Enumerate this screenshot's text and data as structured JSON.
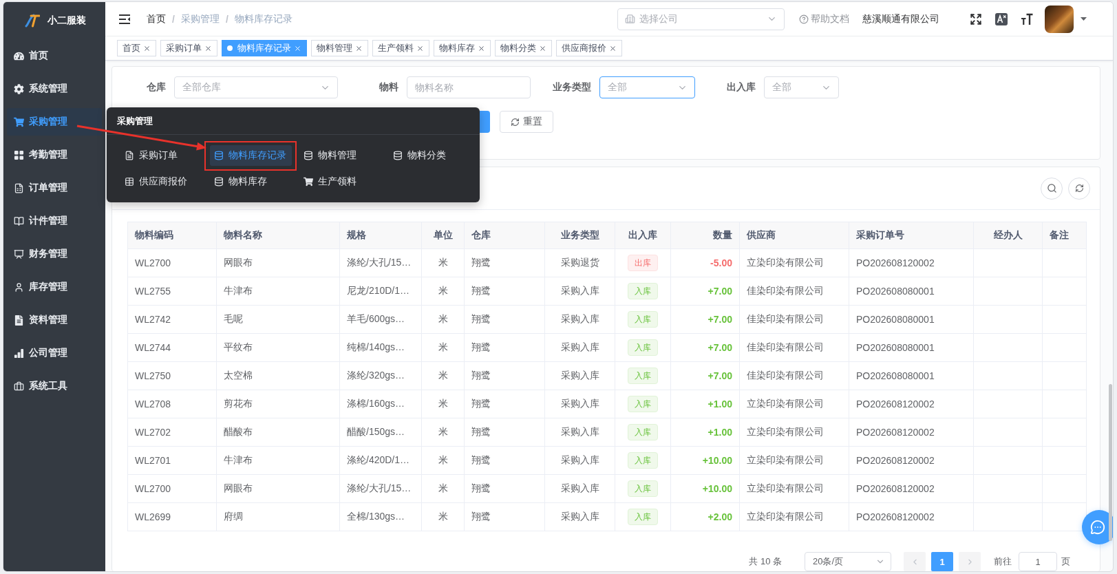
{
  "sidebar": {
    "logo": "小二服装",
    "items": [
      {
        "label": "首页",
        "selected": false
      },
      {
        "label": "系统管理",
        "selected": false
      },
      {
        "label": "采购管理",
        "selected": true
      },
      {
        "label": "考勤管理",
        "selected": false
      },
      {
        "label": "订单管理",
        "selected": false
      },
      {
        "label": "计件管理",
        "selected": false
      },
      {
        "label": "财务管理",
        "selected": false
      },
      {
        "label": "库存管理",
        "selected": false
      },
      {
        "label": "资料管理",
        "selected": false
      },
      {
        "label": "公司管理",
        "selected": false
      },
      {
        "label": "系统工具",
        "selected": false
      }
    ]
  },
  "header": {
    "breadcrumb": [
      {
        "label": "首页",
        "link": true,
        "separator": "/"
      },
      {
        "label": "采购管理",
        "link": false,
        "separator": "/"
      },
      {
        "label": "物料库存记录",
        "link": false
      }
    ],
    "company_select": {
      "placeholder": "选择公司"
    },
    "help_link": "帮助文档",
    "company_name": "慈溪顺通有限公司"
  },
  "tags": [
    {
      "label": "首页",
      "selected": false
    },
    {
      "label": "采购订单",
      "selected": false
    },
    {
      "label": "物料库存记录",
      "selected": true
    },
    {
      "label": "物料管理",
      "selected": false
    },
    {
      "label": "生产领料",
      "selected": false
    },
    {
      "label": "物料库存",
      "selected": false
    },
    {
      "label": "物料分类",
      "selected": false
    },
    {
      "label": "供应商报价",
      "selected": false
    }
  ],
  "filters": {
    "fields": [
      {
        "label": "仓库",
        "kind": "select",
        "placeholder": "全部仓库",
        "focused": false
      },
      {
        "label": "物料",
        "kind": "input",
        "placeholder": "物料名称",
        "focused": false
      },
      {
        "label": "业务类型",
        "kind": "select",
        "placeholder": "全部",
        "focused": true
      },
      {
        "label": "出入库",
        "kind": "select",
        "placeholder": "全部",
        "focused": false
      }
    ],
    "buttons": [
      {
        "kind": "primary"
      },
      {
        "kind": "reset",
        "label": "重置"
      }
    ]
  },
  "flyout_menu": {
    "title": "采购管理",
    "items": [
      {
        "label": "采购订单",
        "selected": false,
        "highlighted": false
      },
      {
        "label": "物料库存记录",
        "selected": true,
        "highlighted": true
      },
      {
        "label": "物料管理",
        "selected": false,
        "highlighted": false
      },
      {
        "label": "物料分类",
        "selected": false,
        "highlighted": false
      },
      {
        "label": "供应商报价",
        "selected": false,
        "highlighted": false
      },
      {
        "label": "物料库存",
        "selected": false,
        "highlighted": false
      },
      {
        "label": "生产领料",
        "selected": false,
        "highlighted": false
      }
    ]
  },
  "table": {
    "columns": [
      "物料编码",
      "物料名称",
      "规格",
      "单位",
      "仓库",
      "业务类型",
      "出入库",
      "数量",
      "供应商",
      "采购订单号",
      "经办人",
      "备注"
    ],
    "rows": [
      {
        "code": "WL2700",
        "name": "网眼布",
        "spec": "涤纶/大孔/15…",
        "unit": "米",
        "warehouse": "翔鹭",
        "business_type": "采购退货",
        "direction": {
          "label": "出库",
          "kind": "out"
        },
        "quantity": "-5.00",
        "supplier": "立染印染有限公司",
        "po_number": "PO202608120002"
      },
      {
        "code": "WL2755",
        "name": "牛津布",
        "spec": "尼龙/210D/1…",
        "unit": "米",
        "warehouse": "翔鹭",
        "business_type": "采购入库",
        "direction": {
          "label": "入库",
          "kind": "in"
        },
        "quantity": "+7.00",
        "supplier": "佳染印染有限公司",
        "po_number": "PO202608080001"
      },
      {
        "code": "WL2742",
        "name": "毛呢",
        "spec": "羊毛/600gs…",
        "unit": "米",
        "warehouse": "翔鹭",
        "business_type": "采购入库",
        "direction": {
          "label": "入库",
          "kind": "in"
        },
        "quantity": "+7.00",
        "supplier": "佳染印染有限公司",
        "po_number": "PO202608080001"
      },
      {
        "code": "WL2744",
        "name": "平纹布",
        "spec": "纯棉/140gs…",
        "unit": "米",
        "warehouse": "翔鹭",
        "business_type": "采购入库",
        "direction": {
          "label": "入库",
          "kind": "in"
        },
        "quantity": "+7.00",
        "supplier": "佳染印染有限公司",
        "po_number": "PO202608080001"
      },
      {
        "code": "WL2750",
        "name": "太空棉",
        "spec": "涤纶/320gs…",
        "unit": "米",
        "warehouse": "翔鹭",
        "business_type": "采购入库",
        "direction": {
          "label": "入库",
          "kind": "in"
        },
        "quantity": "+7.00",
        "supplier": "佳染印染有限公司",
        "po_number": "PO202608080001"
      },
      {
        "code": "WL2708",
        "name": "剪花布",
        "spec": "涤棉/160gs…",
        "unit": "米",
        "warehouse": "翔鹭",
        "business_type": "采购入库",
        "direction": {
          "label": "入库",
          "kind": "in"
        },
        "quantity": "+1.00",
        "supplier": "立染印染有限公司",
        "po_number": "PO202608120002"
      },
      {
        "code": "WL2702",
        "name": "醋酸布",
        "spec": "醋酸/150gs…",
        "unit": "米",
        "warehouse": "翔鹭",
        "business_type": "采购入库",
        "direction": {
          "label": "入库",
          "kind": "in"
        },
        "quantity": "+1.00",
        "supplier": "立染印染有限公司",
        "po_number": "PO202608120002"
      },
      {
        "code": "WL2701",
        "name": "牛津布",
        "spec": "涤纶/420D/1…",
        "unit": "米",
        "warehouse": "翔鹭",
        "business_type": "采购入库",
        "direction": {
          "label": "入库",
          "kind": "in"
        },
        "quantity": "+10.00",
        "supplier": "立染印染有限公司",
        "po_number": "PO202608120002"
      },
      {
        "code": "WL2700",
        "name": "网眼布",
        "spec": "涤纶/大孔/15…",
        "unit": "米",
        "warehouse": "翔鹭",
        "business_type": "采购入库",
        "direction": {
          "label": "入库",
          "kind": "in"
        },
        "quantity": "+10.00",
        "supplier": "立染印染有限公司",
        "po_number": "PO202608120002"
      },
      {
        "code": "WL2699",
        "name": "府绸",
        "spec": "全棉/130gs…",
        "unit": "米",
        "warehouse": "翔鹭",
        "business_type": "采购入库",
        "direction": {
          "label": "入库",
          "kind": "in"
        },
        "quantity": "+2.00",
        "supplier": "立染印染有限公司",
        "po_number": "PO202608120002"
      }
    ]
  },
  "pagination": {
    "total": "共 10 条",
    "page_size": "20条/页",
    "prev": {
      "disabled": true
    },
    "pages": [
      {
        "label": "1",
        "selected": true
      }
    ],
    "next": {
      "disabled": true
    },
    "jump_label": "前往",
    "jump_value": "1",
    "jump_suffix": "页"
  }
}
